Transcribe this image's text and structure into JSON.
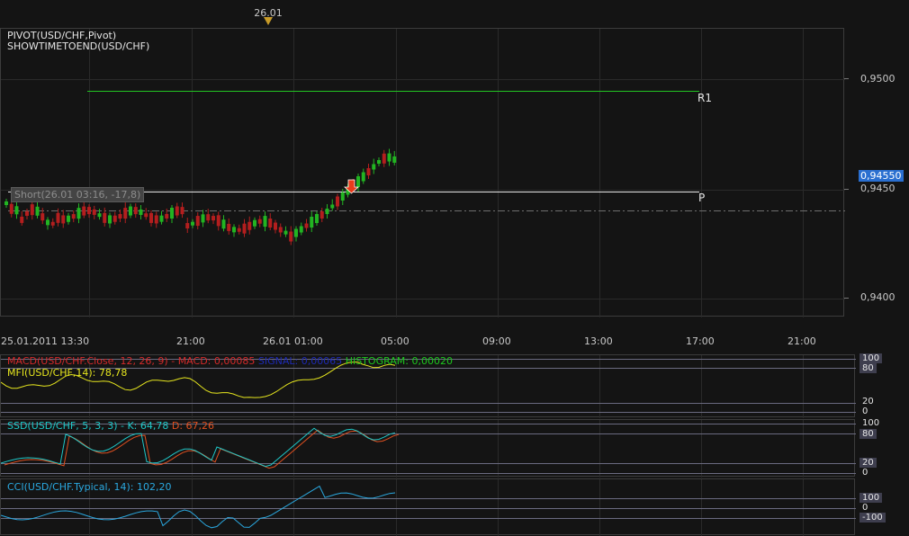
{
  "top_date_marker": "26.01",
  "indicators_header": {
    "line1": "PIVOT(USD/CHF,Pivot)",
    "line2": "SHOWTIMETOEND(USD/CHF)"
  },
  "price_axis": {
    "labels": [
      "0,9500",
      "0,9450",
      "0,9400"
    ],
    "current_price": "0,94550"
  },
  "pivot_labels": {
    "r1": "R1",
    "p": "P"
  },
  "trade_label": "Short(26.01 03:16, -17,8)",
  "time_axis": [
    "25.01.2011 13:30",
    "21:00",
    "26.01 01:00",
    "05:00",
    "09:00",
    "13:00",
    "17:00",
    "21:00"
  ],
  "macd_panel": {
    "macd_label": "MACD(USD/CHF.Close, 12, 26, 9) -",
    "macd_value": "MACD: 0,00085",
    "signal_text": "SIGNAL: 0,00065",
    "hist_text": "HISTOGRAM: 0,00020",
    "mfi_label": "MFI(USD/CHF,14): 78,78",
    "levels": [
      "100",
      "80",
      "20",
      "0"
    ]
  },
  "ssd_panel": {
    "label": "SSD(USD/CHF, 5, 3, 3) -",
    "k_text": "K: 64,78",
    "d_text": "D: 67,26",
    "levels": [
      "100",
      "80",
      "20",
      "0"
    ]
  },
  "cci_panel": {
    "label": "CCI(USD/CHF.Typical, 14): 102,20",
    "levels": [
      "100",
      "0",
      "-100"
    ]
  },
  "colors": {
    "bull": "#22b422",
    "bear": "#b41e1e",
    "r1_line": "#22c422",
    "pivot_line": "#e6e6e6",
    "mfi": "#e6e61e",
    "ssd_k": "#1ec8c8",
    "ssd_d": "#e05020",
    "cci": "#2aa8e0",
    "price_badge": "#2a6fd0"
  }
}
